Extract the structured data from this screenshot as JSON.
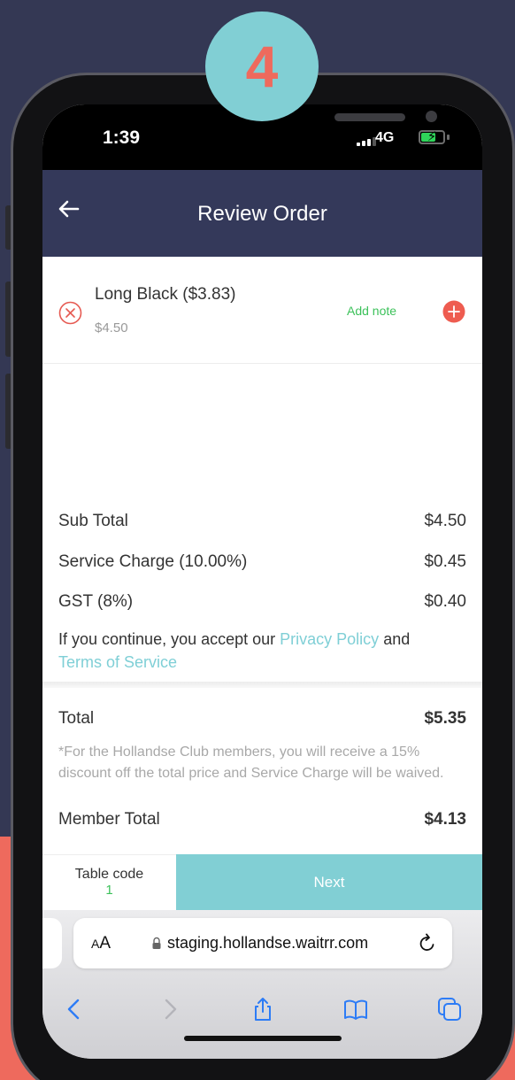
{
  "colors": {
    "background_navy": "#343854",
    "background_coral": "#ee6a5d",
    "header": "#34395a",
    "accent_teal": "#81cfd4",
    "link": "#7fcfd6",
    "green": "#3cc15a",
    "remove_red": "#e65a52"
  },
  "step_badge": {
    "number": "4"
  },
  "status_bar": {
    "time": "1:39",
    "network": "4G"
  },
  "header": {
    "title": "Review Order",
    "back_icon": "arrow-left-icon"
  },
  "order_items": [
    {
      "name": "Long Black ($3.83)",
      "price": "$4.50",
      "note_label": "Add note"
    }
  ],
  "summary": {
    "sub_total_label": "Sub Total",
    "sub_total": "$4.50",
    "service_charge_label": "Service Charge (10.00%)",
    "service_charge": "$0.45",
    "gst_label": "GST (8%)",
    "gst": "$0.40"
  },
  "terms": {
    "prefix": "If you continue, you accept our ",
    "privacy_link": "Privacy Policy",
    "middle": " and",
    "terms_link": "Terms of Service"
  },
  "total": {
    "label": "Total",
    "amount": "$5.35"
  },
  "member": {
    "note": "*For the Hollandse Club members, you will receive a 15% discount off the total price and Service Charge will be waived.",
    "label": "Member Total",
    "amount": "$4.13"
  },
  "bottom_bar": {
    "table_code_label": "Table code",
    "table_code_value": "1",
    "next_label": "Next"
  },
  "browser": {
    "aa_small": "A",
    "aa_large": "A",
    "url": "staging.hollandse.waitrr.com",
    "toolbar_icons": [
      "back-icon",
      "forward-icon",
      "share-icon",
      "bookmarks-icon",
      "tabs-icon"
    ]
  }
}
